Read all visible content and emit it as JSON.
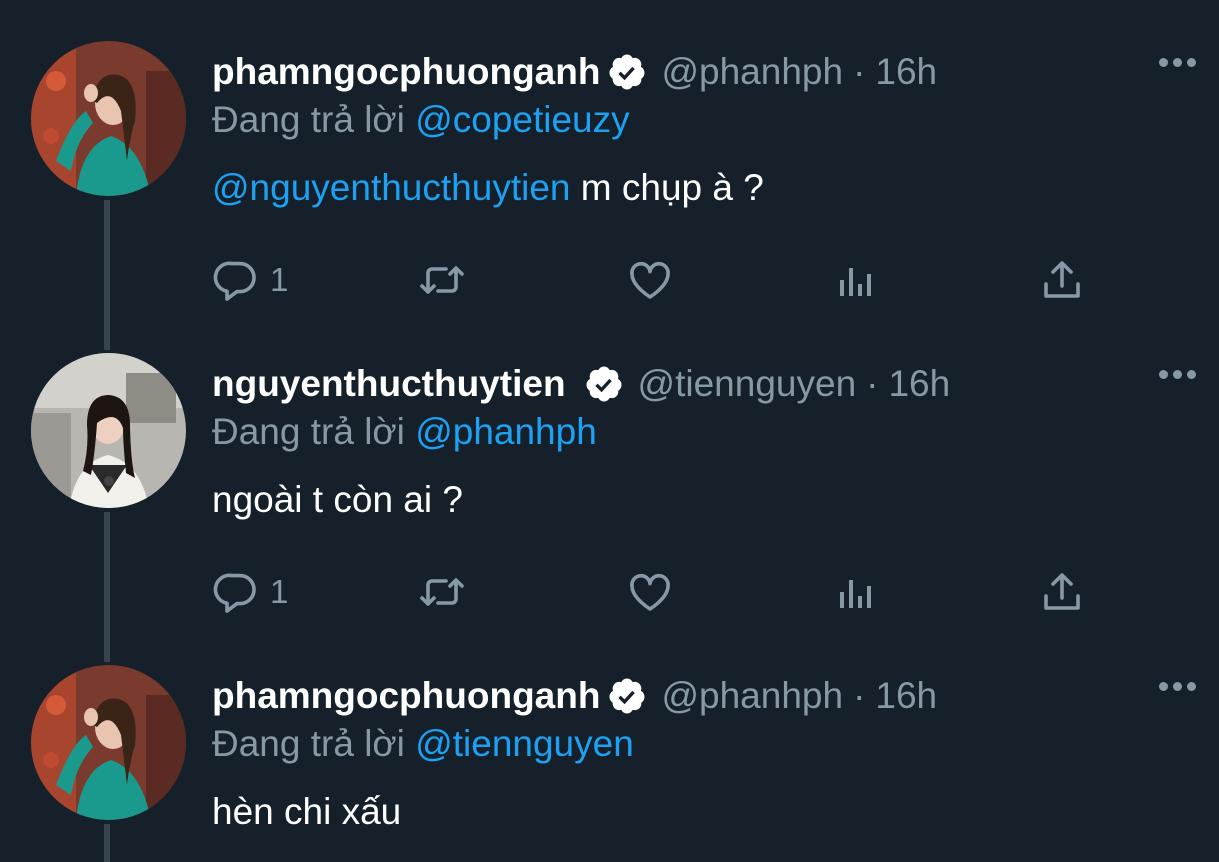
{
  "tweets": [
    {
      "display_name": "phamngocphuonganh",
      "handle": "@phanhph",
      "separator": "·",
      "time": "16h",
      "reply_label": "Đang trả lời",
      "reply_to": "@copetieuzy",
      "mention": "@nguyenthucthuytien",
      "text": " m chụp à ?",
      "reply_count": "1",
      "avatar_colors": {
        "bg": "#7a3b2e",
        "shirt": "#1a9a8c",
        "skin": "#e9c4b0",
        "hair": "#3a2418"
      }
    },
    {
      "display_name": "nguyenthucthuytien",
      "handle": "@tiennguyen",
      "separator": "·",
      "time": "16h",
      "reply_label": "Đang trả lời",
      "reply_to": "@phanhph",
      "mention": "",
      "text": "ngoài t còn ai ?",
      "reply_count": "1",
      "avatar_colors": {
        "bg": "#b8b6b1",
        "shirt": "#f2f0ea",
        "skin": "#edd0c0",
        "hair": "#1c1512"
      }
    },
    {
      "display_name": "phamngocphuonganh",
      "handle": "@phanhph",
      "separator": "·",
      "time": "16h",
      "reply_label": "Đang trả lời",
      "reply_to": "@tiennguyen",
      "mention": "",
      "text": "hèn chi xấu",
      "reply_count": "",
      "avatar_colors": {
        "bg": "#7a3b2e",
        "shirt": "#1a9a8c",
        "skin": "#e9c4b0",
        "hair": "#3a2418"
      }
    }
  ],
  "theme": {
    "background": "#15202b",
    "accent": "#1da1f2",
    "muted": "#8899a6",
    "thread_line": "#38444d"
  },
  "icons": {
    "reply": "reply-icon",
    "retweet": "retweet-icon",
    "like": "heart-icon",
    "stats": "analytics-icon",
    "share": "share-icon",
    "verified": "verified-badge-icon",
    "more": "more-options-icon"
  }
}
